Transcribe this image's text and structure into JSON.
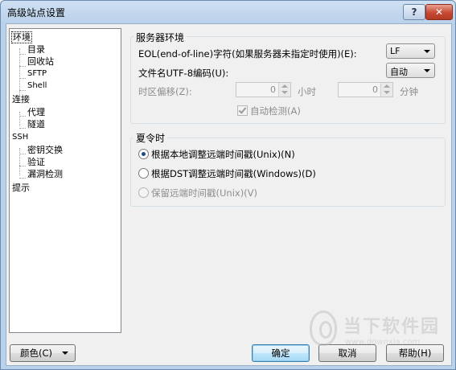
{
  "window": {
    "title": "高级站点设置",
    "help_glyph": "?",
    "close_glyph": "✕"
  },
  "tree": {
    "items": [
      {
        "label": "环境",
        "name": "tree-item-environment",
        "selected": true
      },
      {
        "label": "目录",
        "name": "tree-item-directories"
      },
      {
        "label": "回收站",
        "name": "tree-item-recycle-bin"
      },
      {
        "label": "SFTP",
        "name": "tree-item-sftp"
      },
      {
        "label": "Shell",
        "name": "tree-item-shell"
      },
      {
        "label": "连接",
        "name": "tree-item-connection"
      },
      {
        "label": "代理",
        "name": "tree-item-proxy"
      },
      {
        "label": "隧道",
        "name": "tree-item-tunnel"
      },
      {
        "label": "SSH",
        "name": "tree-item-ssh"
      },
      {
        "label": "密钥交换",
        "name": "tree-item-key-exchange"
      },
      {
        "label": "验证",
        "name": "tree-item-authentication"
      },
      {
        "label": "漏洞检测",
        "name": "tree-item-bugs"
      },
      {
        "label": "提示",
        "name": "tree-item-note"
      }
    ]
  },
  "server_env": {
    "title": "服务器环境",
    "eol_label": "EOL(end-of-line)字符(如果服务器未指定时使用)(E):",
    "eol_value": "LF",
    "utf8_label": "文件名UTF-8编码(U):",
    "utf8_value": "自动",
    "tz_label": "时区偏移(Z):",
    "tz_hours_value": "0",
    "tz_hours_unit": "小时",
    "tz_minutes_value": "0",
    "tz_minutes_unit": "分钟",
    "auto_detect_label": "自动检测(A)"
  },
  "dst": {
    "title": "夏令时",
    "options": [
      {
        "label": "根据本地调整远端时间戳(Unix)(N)",
        "selected": true,
        "enabled": true
      },
      {
        "label": "根据DST调整远端时间戳(Windows)(D)",
        "selected": false,
        "enabled": true
      },
      {
        "label": "保留远端时间戳(Unix)(V)",
        "selected": false,
        "enabled": false
      }
    ]
  },
  "buttons": {
    "color": "颜色(C)",
    "ok": "确定",
    "cancel": "取消",
    "help": "帮助(H)"
  },
  "watermark": {
    "text": "当下软件园",
    "url": "www.downxia.com"
  }
}
